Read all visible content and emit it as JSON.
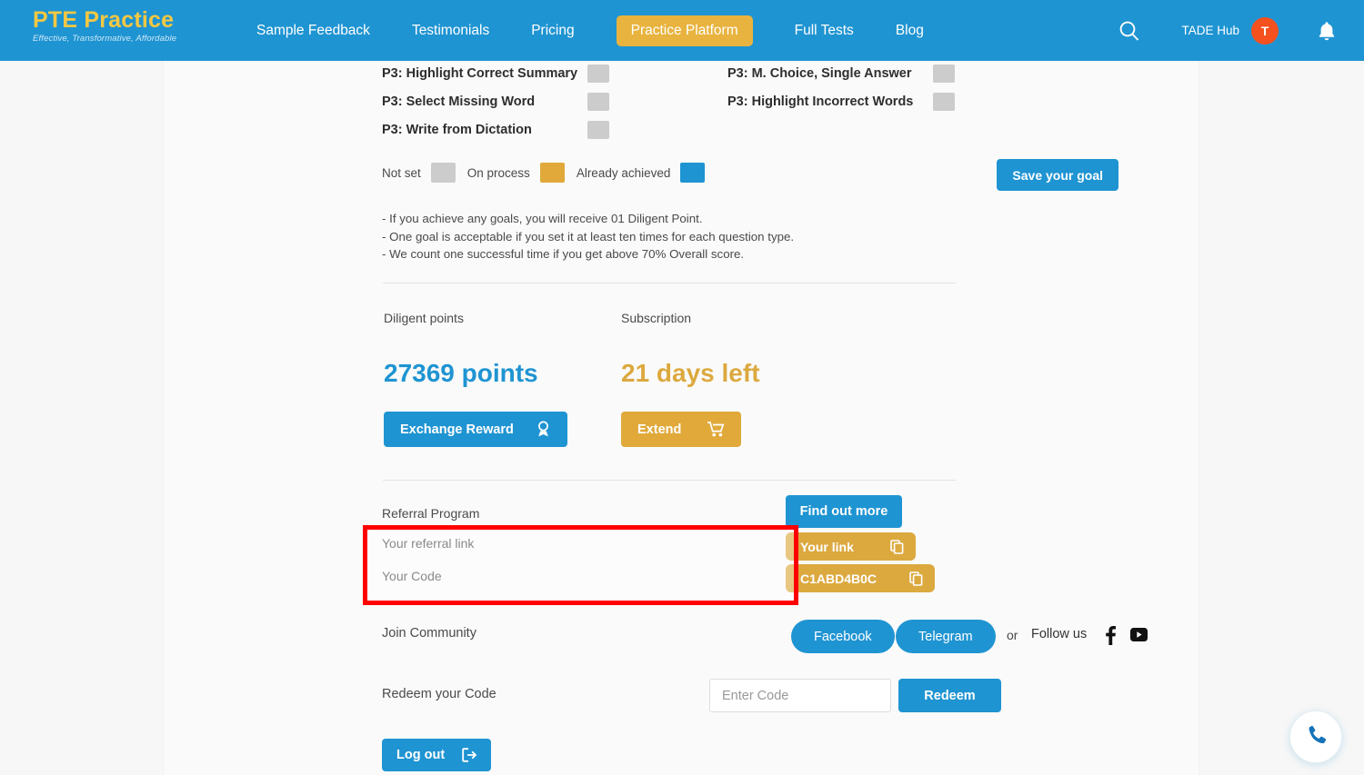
{
  "nav": {
    "brand_title": "PTE Practice",
    "brand_tagline": "Effective, Transformative, Affordable",
    "links": [
      {
        "label": "Sample Feedback",
        "active": false
      },
      {
        "label": "Testimonials",
        "active": false
      },
      {
        "label": "Pricing",
        "active": false
      },
      {
        "label": "Practice Platform",
        "active": true
      },
      {
        "label": "Full Tests",
        "active": false
      },
      {
        "label": "Blog",
        "active": false
      }
    ],
    "search_icon": "search-icon",
    "user_name": "TADE Hub",
    "avatar_initial": "T",
    "bell_icon": "bell-icon",
    "bar_color": "#1f94d2",
    "active_pill_color": "#e8b33e",
    "avatar_color": "#f4511e"
  },
  "goals": {
    "left_column": [
      {
        "label": "P3: Highlight Correct Summary",
        "state": "Not set"
      },
      {
        "label": "P3: Select Missing Word",
        "state": "Not set"
      },
      {
        "label": "P3: Write from Dictation",
        "state": "Not set"
      }
    ],
    "right_column": [
      {
        "label": "P3: M. Choice, Single Answer",
        "state": "Not set"
      },
      {
        "label": "P3: Highlight Incorrect Words",
        "state": "Not set"
      }
    ],
    "legend": [
      {
        "label": "Not set",
        "color": "#cccccc"
      },
      {
        "label": "On process",
        "color": "#e0a93a"
      },
      {
        "label": "Already achieved",
        "color": "#1f94d2"
      }
    ],
    "save_button": "Save your goal",
    "notes": [
      "- If you achieve any goals, you will receive 01 Diligent Point.",
      "- One goal is acceptable if you set it at least ten times for each question type.",
      "- We count one successful time if you get above 70% Overall score."
    ]
  },
  "stats": {
    "points": {
      "label": "Diligent points",
      "value": "27369 points",
      "button": "Exchange Reward",
      "button_icon": "award-medal-icon",
      "value_color": "#1f94d2"
    },
    "subscription": {
      "label": "Subscription",
      "value": "21 days left",
      "button": "Extend",
      "button_icon": "shopping-cart-icon",
      "value_color": "#dca93f"
    }
  },
  "referral": {
    "program_label": "Referral Program",
    "find_out_more": "Find out more",
    "link_label": "Your referral link",
    "link_button": "Your link",
    "code_label": "Your Code",
    "code_button": "C1ABD4B0C",
    "copy_icon": "copy-icon",
    "highlight_color": "#ff0000"
  },
  "community": {
    "label": "Join Community",
    "facebook_button": "Facebook",
    "telegram_button": "Telegram",
    "or_text": "or",
    "follow_text": "Follow us",
    "facebook_icon": "facebook-icon",
    "youtube_icon": "youtube-icon"
  },
  "redeem": {
    "label": "Redeem your Code",
    "placeholder": "Enter Code",
    "value": "",
    "button": "Redeem"
  },
  "account": {
    "logout_button": "Log out",
    "logout_icon": "sign-out-icon"
  },
  "fab": {
    "icon": "phone-icon"
  }
}
